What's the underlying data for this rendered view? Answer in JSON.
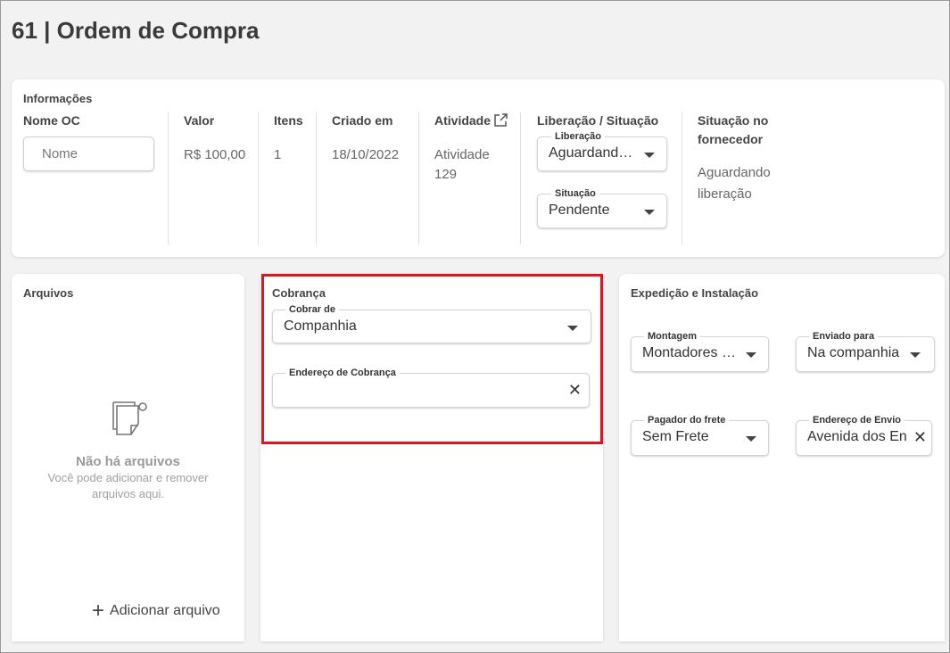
{
  "page": {
    "title": "61 | Ordem de Compra"
  },
  "info": {
    "section_title": "Informações",
    "name_oc": {
      "label": "Nome OC",
      "placeholder": "Nome"
    },
    "valor": {
      "label": "Valor",
      "value": "R$ 100,00"
    },
    "itens": {
      "label": "Itens",
      "value": "1"
    },
    "criado_em": {
      "label": "Criado em",
      "value": "18/10/2022"
    },
    "atividade": {
      "label": "Atividade",
      "value_line1": "Atividade",
      "value_line2": "129",
      "icon": "external-link-icon"
    },
    "liberacao_situacao": {
      "label": "Liberação / Situação",
      "liberacao": {
        "label": "Liberação",
        "value": "Aguardando liberação"
      },
      "situacao": {
        "label": "Situação",
        "value": "Pendente"
      }
    },
    "situacao_fornecedor": {
      "label_line1": "Situação no",
      "label_line2": "fornecedor",
      "value_line1": "Aguardando",
      "value_line2": "liberação"
    }
  },
  "arquivos": {
    "section_title": "Arquivos",
    "empty_icon": "document-icon",
    "empty_title": "Não há arquivos",
    "empty_desc": "Você pode adicionar e remover arquivos aqui.",
    "add_label": "Adicionar arquivo"
  },
  "cobranca": {
    "section_title": "Cobrança",
    "cobrar_de": {
      "label": "Cobrar de",
      "value": "Companhia"
    },
    "endereco": {
      "label": "Endereço de Cobrança",
      "value": ""
    }
  },
  "expedicao": {
    "section_title": "Expedição e Instalação",
    "montagem": {
      "label": "Montagem",
      "value": "Montadores da casa"
    },
    "enviado_para": {
      "label": "Enviado para",
      "value": "Na companhia"
    },
    "pagador_frete": {
      "label": "Pagador do frete",
      "value": "Sem Frete"
    },
    "endereco_envio": {
      "label": "Endereço de Envio",
      "value": "Avenida dos Engenheiros"
    }
  },
  "colors": {
    "highlight": "#e0141e",
    "background": "#f2f2f2",
    "card": "#ffffff"
  }
}
